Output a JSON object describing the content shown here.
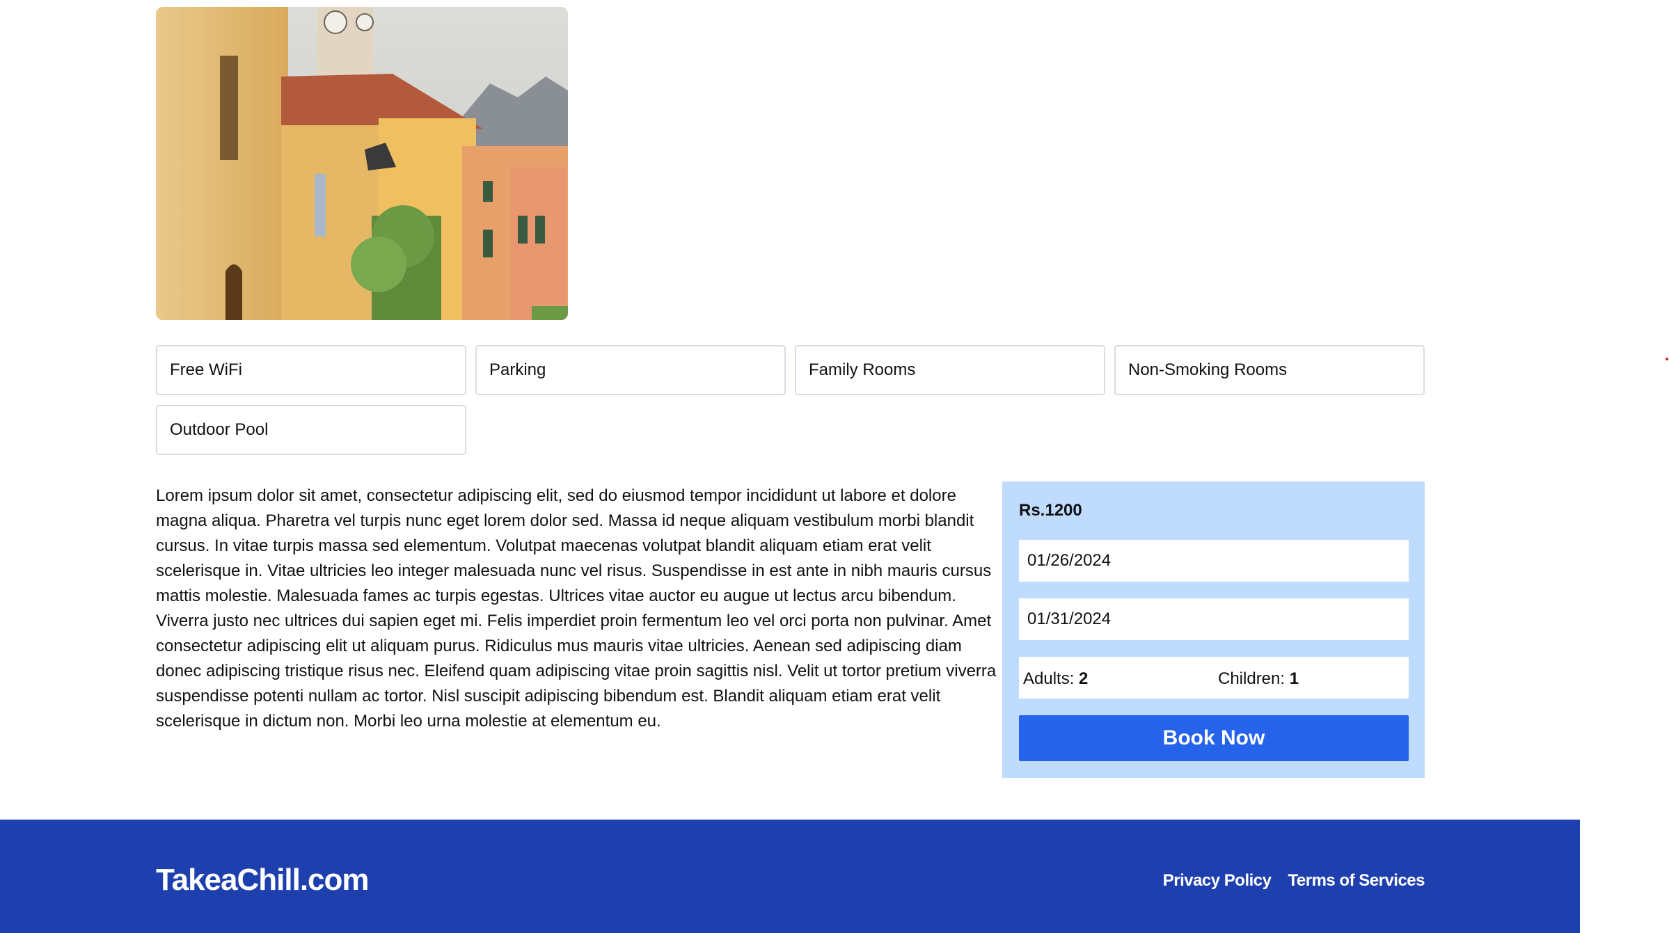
{
  "facilities": [
    "Free WiFi",
    "Parking",
    "Family Rooms",
    "Non-Smoking Rooms",
    "Outdoor Pool"
  ],
  "description": "Lorem ipsum dolor sit amet, consectetur adipiscing elit, sed do eiusmod tempor incididunt ut labore et dolore magna aliqua. Pharetra vel turpis nunc eget lorem dolor sed. Massa id neque aliquam vestibulum morbi blandit cursus. In vitae turpis massa sed elementum. Volutpat maecenas volutpat blandit aliquam etiam erat velit scelerisque in. Vitae ultricies leo integer malesuada nunc vel risus. Suspendisse in est ante in nibh mauris cursus mattis molestie. Malesuada fames ac turpis egestas. Ultrices vitae auctor eu augue ut lectus arcu bibendum. Viverra justo nec ultrices dui sapien eget mi. Felis imperdiet proin fermentum leo vel orci porta non pulvinar. Amet consectetur adipiscing elit ut aliquam purus. Ridiculus mus mauris vitae ultricies. Aenean sed adipiscing diam donec adipiscing tristique risus nec. Eleifend quam adipiscing vitae proin sagittis nisl. Velit ut tortor pretium viverra suspendisse potenti nullam ac tortor. Nisl suscipit adipiscing bibendum est. Blandit aliquam etiam erat velit scelerisque in dictum non. Morbi leo urna molestie at elementum eu.",
  "booking": {
    "price": "Rs.1200",
    "check_in": "01/26/2024",
    "check_out": "01/31/2024",
    "adults_label": "Adults:",
    "adults_value": "2",
    "children_label": "Children:",
    "children_value": "1",
    "book_label": "Book Now"
  },
  "footer": {
    "brand": "TakeaChill.com",
    "links": [
      "Privacy Policy",
      "Terms of Services"
    ]
  },
  "colors": {
    "panel_bg": "#bfdbfe",
    "button": "#2563eb",
    "footer_bg": "#1e40af"
  }
}
